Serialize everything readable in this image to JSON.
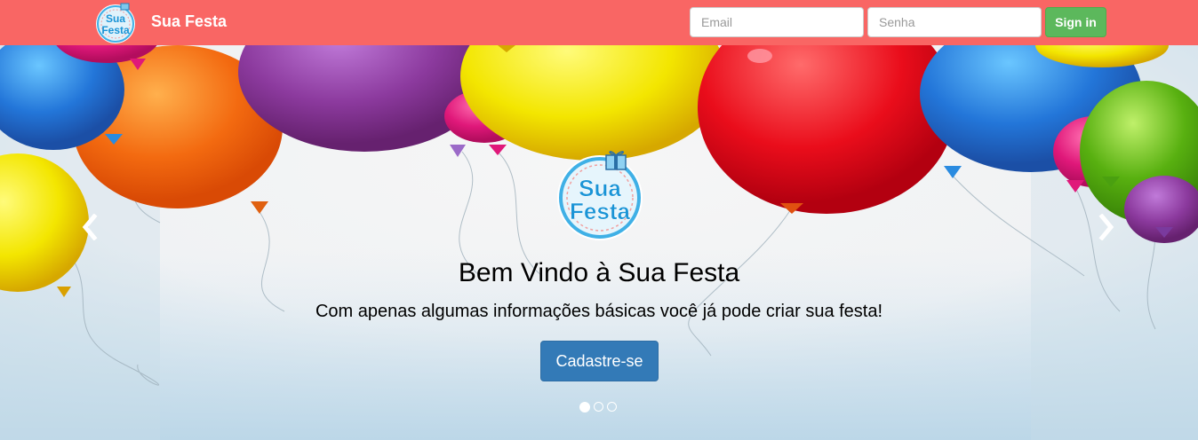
{
  "navbar": {
    "brand_name": "Sua Festa",
    "logo_text_line1": "Sua",
    "logo_text_line2": "Festa",
    "email_placeholder": "Email",
    "senha_placeholder": "Senha",
    "signin_label": "Sign in",
    "bg_color": "#f96664"
  },
  "carousel": {
    "title": "Bem Vindo à Sua Festa",
    "subtitle": "Com apenas algumas informações básicas você já pode criar sua festa!",
    "cta_label": "Cadastre-se",
    "prev_icon": "chevron-left-icon",
    "next_icon": "chevron-right-icon",
    "indicators": [
      {
        "active": true
      },
      {
        "active": false
      },
      {
        "active": false
      }
    ]
  },
  "colors": {
    "cta": "#337ab7",
    "signin": "#5cb85c"
  }
}
